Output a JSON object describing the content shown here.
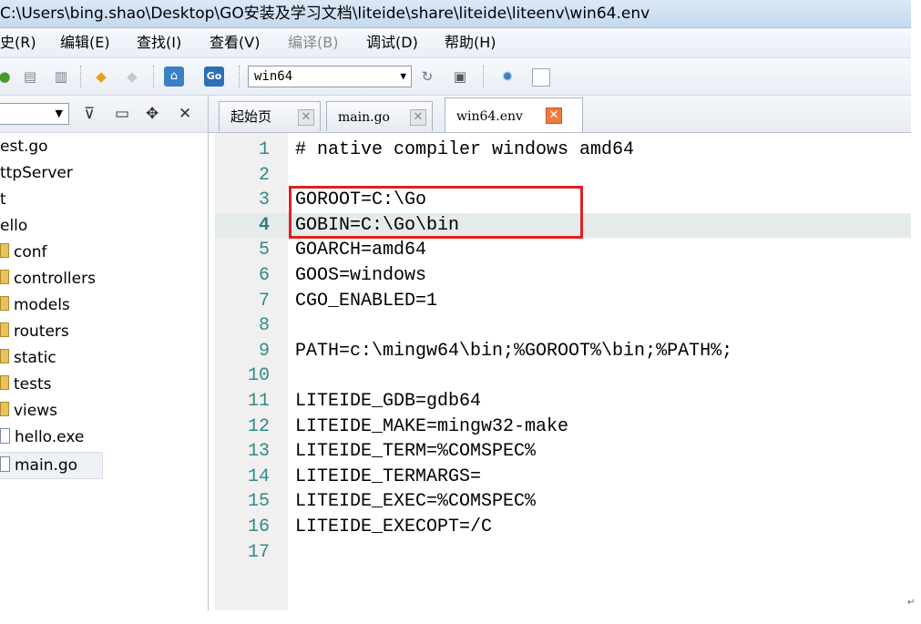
{
  "window": {
    "title": "C:\\Users\\bing.shao\\Desktop\\GO安装及学习文档\\liteide\\share\\liteide\\liteenv\\win64.env"
  },
  "menu": [
    {
      "label": "史(R)",
      "enabled": true
    },
    {
      "label": "编辑(E)",
      "enabled": true
    },
    {
      "label": "查找(I)",
      "enabled": true
    },
    {
      "label": "查看(V)",
      "enabled": true
    },
    {
      "label": "编译(B)",
      "enabled": false
    },
    {
      "label": "调试(D)",
      "enabled": true
    },
    {
      "label": "帮助(H)",
      "enabled": true
    }
  ],
  "toolbar": {
    "env_select": {
      "value": "win64"
    },
    "go_icon_label": "Go"
  },
  "project_tree": {
    "items": [
      {
        "label": "est.go",
        "type": "file"
      },
      {
        "label": "ttpServer",
        "type": "folder"
      },
      {
        "label": "t",
        "type": "folder"
      },
      {
        "label": "ello",
        "type": "folder"
      },
      {
        "label": "conf",
        "type": "folder"
      },
      {
        "label": "controllers",
        "type": "folder"
      },
      {
        "label": "models",
        "type": "folder"
      },
      {
        "label": "routers",
        "type": "folder"
      },
      {
        "label": "static",
        "type": "folder"
      },
      {
        "label": "tests",
        "type": "folder"
      },
      {
        "label": "views",
        "type": "folder"
      },
      {
        "label": "hello.exe",
        "type": "file"
      },
      {
        "label": "main.go",
        "type": "file",
        "selected": true
      }
    ]
  },
  "tabs": [
    {
      "label": "起始页",
      "active": false
    },
    {
      "label": "main.go",
      "active": false
    },
    {
      "label": "win64.env",
      "active": true
    }
  ],
  "editor": {
    "current_line": 4,
    "highlighted_lines": [
      3,
      4
    ],
    "highlight_color": "#e02020",
    "lines": [
      {
        "n": "1",
        "text": "# native compiler windows amd64"
      },
      {
        "n": "2",
        "text": ""
      },
      {
        "n": "3",
        "text": "GOROOT=C:\\Go"
      },
      {
        "n": "4",
        "text": "GOBIN=C:\\Go\\bin"
      },
      {
        "n": "5",
        "text": "GOARCH=amd64"
      },
      {
        "n": "6",
        "text": "GOOS=windows"
      },
      {
        "n": "7",
        "text": "CGO_ENABLED=1"
      },
      {
        "n": "8",
        "text": ""
      },
      {
        "n": "9",
        "text": "PATH=c:\\mingw64\\bin;%GOROOT%\\bin;%PATH%;"
      },
      {
        "n": "10",
        "text": ""
      },
      {
        "n": "11",
        "text": "LITEIDE_GDB=gdb64"
      },
      {
        "n": "12",
        "text": "LITEIDE_MAKE=mingw32-make"
      },
      {
        "n": "13",
        "text": "LITEIDE_TERM=%COMSPEC%"
      },
      {
        "n": "14",
        "text": "LITEIDE_TERMARGS="
      },
      {
        "n": "15",
        "text": "LITEIDE_EXEC=%COMSPEC%"
      },
      {
        "n": "16",
        "text": "LITEIDE_EXECOPT=/C"
      },
      {
        "n": "17",
        "text": ""
      }
    ]
  },
  "colors": {
    "line_number": "#2f8b8b",
    "current_line_bg": "#e4ebea",
    "active_tab_close": "#f07b3f"
  }
}
